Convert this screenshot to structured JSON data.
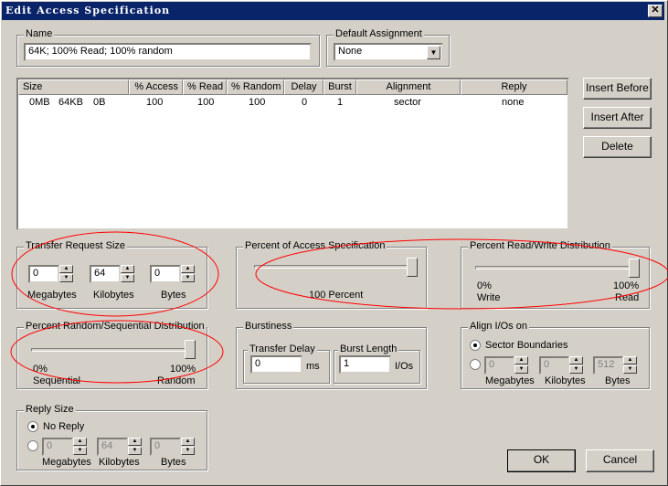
{
  "window": {
    "title": "Edit Access Specification",
    "close": "✕"
  },
  "name": {
    "label": "Name",
    "value": "64K; 100% Read; 100% random"
  },
  "default_assignment": {
    "label": "Default Assignment",
    "value": "None"
  },
  "table": {
    "columns": [
      "Size",
      "% Access",
      "% Read",
      "% Random",
      "Delay",
      "Burst",
      "Alignment",
      "Reply"
    ],
    "rows": [
      {
        "size_mb": "0MB",
        "size_kb": "64KB",
        "size_b": "0B",
        "access": "100",
        "read": "100",
        "random": "100",
        "delay": "0",
        "burst": "1",
        "alignment": "sector",
        "reply": "none"
      }
    ]
  },
  "buttons": {
    "insert_before": "Insert Before",
    "insert_after": "Insert After",
    "delete": "Delete",
    "ok": "OK",
    "cancel": "Cancel"
  },
  "transfer_size": {
    "label": "Transfer Request Size",
    "megabytes": "0",
    "kilobytes": "64",
    "bytes": "0",
    "mb_label": "Megabytes",
    "kb_label": "Kilobytes",
    "b_label": "Bytes"
  },
  "percent_access": {
    "label": "Percent of Access Specification",
    "value_percent": 100,
    "caption": "100 Percent"
  },
  "read_write": {
    "label": "Percent Read/Write Distribution",
    "read_percent": 100,
    "left_pct": "0%",
    "left_label": "Write",
    "right_pct": "100%",
    "right_label": "Read"
  },
  "random_seq": {
    "label": "Percent Random/Sequential Distribution",
    "random_percent": 100,
    "left_pct": "0%",
    "left_label": "Sequential",
    "right_pct": "100%",
    "right_label": "Random"
  },
  "burstiness": {
    "label": "Burstiness",
    "delay_label": "Transfer Delay",
    "delay_value": "0",
    "delay_unit": "ms",
    "burst_label": "Burst Length",
    "burst_value": "1",
    "burst_unit": "I/Os"
  },
  "align": {
    "label": "Align I/Os on",
    "sector": "Sector Boundaries",
    "megabytes": "0",
    "kilobytes": "0",
    "bytes": "512",
    "mb_label": "Megabytes",
    "kb_label": "Kilobytes",
    "b_label": "Bytes"
  },
  "reply": {
    "label": "Reply Size",
    "no_reply": "No Reply",
    "megabytes": "0",
    "kilobytes": "64",
    "bytes": "0",
    "mb_label": "Megabytes",
    "kb_label": "Kilobytes",
    "b_label": "Bytes"
  },
  "colors": {
    "titlebar": "#0a246a",
    "annotation": "#ff0000",
    "face": "#d4d0c8"
  }
}
